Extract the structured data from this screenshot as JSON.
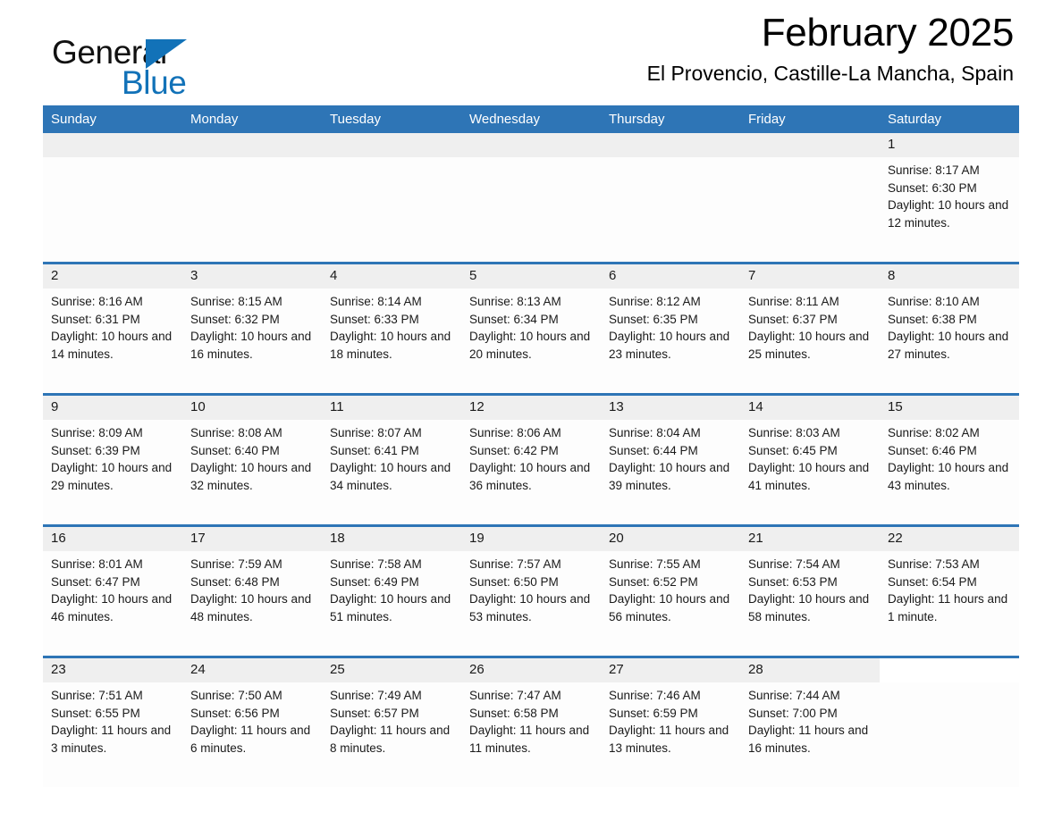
{
  "brand": {
    "name_part1": "General",
    "name_part2": "Blue",
    "accent_color": "#1272b8"
  },
  "header": {
    "month_title": "February 2025",
    "location": "El Provencio, Castille-La Mancha, Spain",
    "header_bg": "#2e75b6",
    "daynum_bg": "#efefef"
  },
  "weekdays": [
    "Sunday",
    "Monday",
    "Tuesday",
    "Wednesday",
    "Thursday",
    "Friday",
    "Saturday"
  ],
  "weeks": [
    [
      {
        "day": "",
        "sunrise": "",
        "sunset": "",
        "daylight": ""
      },
      {
        "day": "",
        "sunrise": "",
        "sunset": "",
        "daylight": ""
      },
      {
        "day": "",
        "sunrise": "",
        "sunset": "",
        "daylight": ""
      },
      {
        "day": "",
        "sunrise": "",
        "sunset": "",
        "daylight": ""
      },
      {
        "day": "",
        "sunrise": "",
        "sunset": "",
        "daylight": ""
      },
      {
        "day": "",
        "sunrise": "",
        "sunset": "",
        "daylight": ""
      },
      {
        "day": "1",
        "sunrise": "Sunrise: 8:17 AM",
        "sunset": "Sunset: 6:30 PM",
        "daylight": "Daylight: 10 hours and 12 minutes."
      }
    ],
    [
      {
        "day": "2",
        "sunrise": "Sunrise: 8:16 AM",
        "sunset": "Sunset: 6:31 PM",
        "daylight": "Daylight: 10 hours and 14 minutes."
      },
      {
        "day": "3",
        "sunrise": "Sunrise: 8:15 AM",
        "sunset": "Sunset: 6:32 PM",
        "daylight": "Daylight: 10 hours and 16 minutes."
      },
      {
        "day": "4",
        "sunrise": "Sunrise: 8:14 AM",
        "sunset": "Sunset: 6:33 PM",
        "daylight": "Daylight: 10 hours and 18 minutes."
      },
      {
        "day": "5",
        "sunrise": "Sunrise: 8:13 AM",
        "sunset": "Sunset: 6:34 PM",
        "daylight": "Daylight: 10 hours and 20 minutes."
      },
      {
        "day": "6",
        "sunrise": "Sunrise: 8:12 AM",
        "sunset": "Sunset: 6:35 PM",
        "daylight": "Daylight: 10 hours and 23 minutes."
      },
      {
        "day": "7",
        "sunrise": "Sunrise: 8:11 AM",
        "sunset": "Sunset: 6:37 PM",
        "daylight": "Daylight: 10 hours and 25 minutes."
      },
      {
        "day": "8",
        "sunrise": "Sunrise: 8:10 AM",
        "sunset": "Sunset: 6:38 PM",
        "daylight": "Daylight: 10 hours and 27 minutes."
      }
    ],
    [
      {
        "day": "9",
        "sunrise": "Sunrise: 8:09 AM",
        "sunset": "Sunset: 6:39 PM",
        "daylight": "Daylight: 10 hours and 29 minutes."
      },
      {
        "day": "10",
        "sunrise": "Sunrise: 8:08 AM",
        "sunset": "Sunset: 6:40 PM",
        "daylight": "Daylight: 10 hours and 32 minutes."
      },
      {
        "day": "11",
        "sunrise": "Sunrise: 8:07 AM",
        "sunset": "Sunset: 6:41 PM",
        "daylight": "Daylight: 10 hours and 34 minutes."
      },
      {
        "day": "12",
        "sunrise": "Sunrise: 8:06 AM",
        "sunset": "Sunset: 6:42 PM",
        "daylight": "Daylight: 10 hours and 36 minutes."
      },
      {
        "day": "13",
        "sunrise": "Sunrise: 8:04 AM",
        "sunset": "Sunset: 6:44 PM",
        "daylight": "Daylight: 10 hours and 39 minutes."
      },
      {
        "day": "14",
        "sunrise": "Sunrise: 8:03 AM",
        "sunset": "Sunset: 6:45 PM",
        "daylight": "Daylight: 10 hours and 41 minutes."
      },
      {
        "day": "15",
        "sunrise": "Sunrise: 8:02 AM",
        "sunset": "Sunset: 6:46 PM",
        "daylight": "Daylight: 10 hours and 43 minutes."
      }
    ],
    [
      {
        "day": "16",
        "sunrise": "Sunrise: 8:01 AM",
        "sunset": "Sunset: 6:47 PM",
        "daylight": "Daylight: 10 hours and 46 minutes."
      },
      {
        "day": "17",
        "sunrise": "Sunrise: 7:59 AM",
        "sunset": "Sunset: 6:48 PM",
        "daylight": "Daylight: 10 hours and 48 minutes."
      },
      {
        "day": "18",
        "sunrise": "Sunrise: 7:58 AM",
        "sunset": "Sunset: 6:49 PM",
        "daylight": "Daylight: 10 hours and 51 minutes."
      },
      {
        "day": "19",
        "sunrise": "Sunrise: 7:57 AM",
        "sunset": "Sunset: 6:50 PM",
        "daylight": "Daylight: 10 hours and 53 minutes."
      },
      {
        "day": "20",
        "sunrise": "Sunrise: 7:55 AM",
        "sunset": "Sunset: 6:52 PM",
        "daylight": "Daylight: 10 hours and 56 minutes."
      },
      {
        "day": "21",
        "sunrise": "Sunrise: 7:54 AM",
        "sunset": "Sunset: 6:53 PM",
        "daylight": "Daylight: 10 hours and 58 minutes."
      },
      {
        "day": "22",
        "sunrise": "Sunrise: 7:53 AM",
        "sunset": "Sunset: 6:54 PM",
        "daylight": "Daylight: 11 hours and 1 minute."
      }
    ],
    [
      {
        "day": "23",
        "sunrise": "Sunrise: 7:51 AM",
        "sunset": "Sunset: 6:55 PM",
        "daylight": "Daylight: 11 hours and 3 minutes."
      },
      {
        "day": "24",
        "sunrise": "Sunrise: 7:50 AM",
        "sunset": "Sunset: 6:56 PM",
        "daylight": "Daylight: 11 hours and 6 minutes."
      },
      {
        "day": "25",
        "sunrise": "Sunrise: 7:49 AM",
        "sunset": "Sunset: 6:57 PM",
        "daylight": "Daylight: 11 hours and 8 minutes."
      },
      {
        "day": "26",
        "sunrise": "Sunrise: 7:47 AM",
        "sunset": "Sunset: 6:58 PM",
        "daylight": "Daylight: 11 hours and 11 minutes."
      },
      {
        "day": "27",
        "sunrise": "Sunrise: 7:46 AM",
        "sunset": "Sunset: 6:59 PM",
        "daylight": "Daylight: 11 hours and 13 minutes."
      },
      {
        "day": "28",
        "sunrise": "Sunrise: 7:44 AM",
        "sunset": "Sunset: 7:00 PM",
        "daylight": "Daylight: 11 hours and 16 minutes."
      },
      {
        "day": "",
        "sunrise": "",
        "sunset": "",
        "daylight": ""
      }
    ]
  ]
}
